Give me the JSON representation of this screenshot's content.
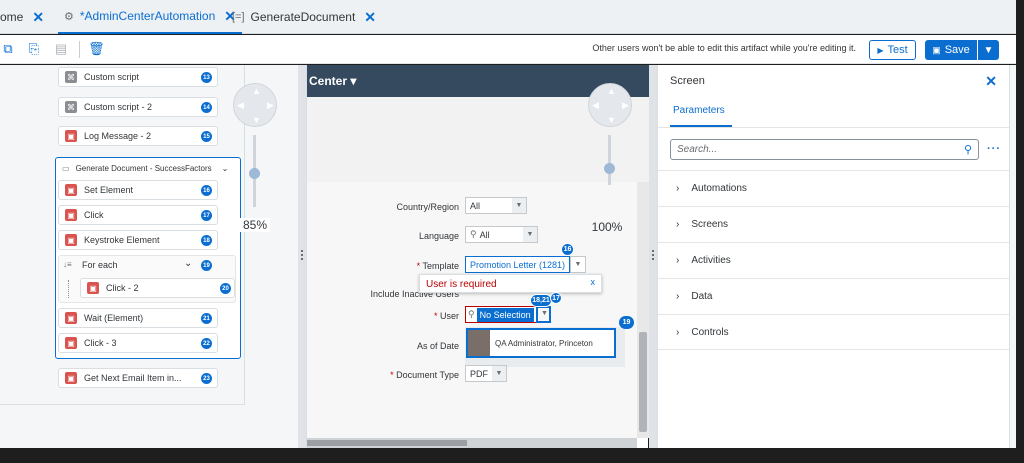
{
  "tabs": [
    {
      "label": "ome",
      "close": "✕"
    },
    {
      "label": "*AdminCenterAutomation",
      "close": "✕"
    },
    {
      "label": "GenerateDocument",
      "close": "✕"
    }
  ],
  "toolbar": {
    "message": "Other users won't be able to edit this artifact while you're editing it.",
    "test_label": "Test",
    "save_label": "Save"
  },
  "canvas": {
    "steps": [
      {
        "label": "Custom script",
        "num": "13"
      },
      {
        "label": "Custom script - 2",
        "num": "14"
      },
      {
        "label": "Log Message - 2",
        "num": "15"
      },
      {
        "label": "Set Element",
        "num": "16"
      },
      {
        "label": "Click",
        "num": "17"
      },
      {
        "label": "Keystroke Element",
        "num": "18"
      },
      {
        "label": "For each",
        "num": "19"
      },
      {
        "label": "Click - 2",
        "num": "20"
      },
      {
        "label": "Wait (Element)",
        "num": "21"
      },
      {
        "label": "Click - 3",
        "num": "22"
      },
      {
        "label": "Get Next Email Item in...",
        "num": "23"
      }
    ],
    "group_title": "Generate Document - SuccessFactors",
    "zoom_left": "85%"
  },
  "form": {
    "header": "Center ▾",
    "zoom": "100%",
    "country_label": "Country/Region",
    "country_value": "All",
    "language_label": "Language",
    "language_value": "All",
    "template_label": "Template",
    "template_value": "Promotion Letter (1281)",
    "template_badge": "16",
    "inactive_label": "Include Inactive Users",
    "error_text": "User is required",
    "error_close": "x",
    "user_label": "User",
    "user_value": "No Selection",
    "user_badges": "18,21",
    "user_badge2": "17",
    "user_badge3": "19",
    "asofdate_label": "As of Date",
    "suggestion": "QA Administrator, Princeton",
    "doctype_label": "Document Type",
    "doctype_value": "PDF",
    "required_mark": "*"
  },
  "right_panel": {
    "title": "Screen",
    "tab": "Parameters",
    "search_placeholder": "Search...",
    "sections": [
      "Automations",
      "Screens",
      "Activities",
      "Data",
      "Controls"
    ]
  }
}
